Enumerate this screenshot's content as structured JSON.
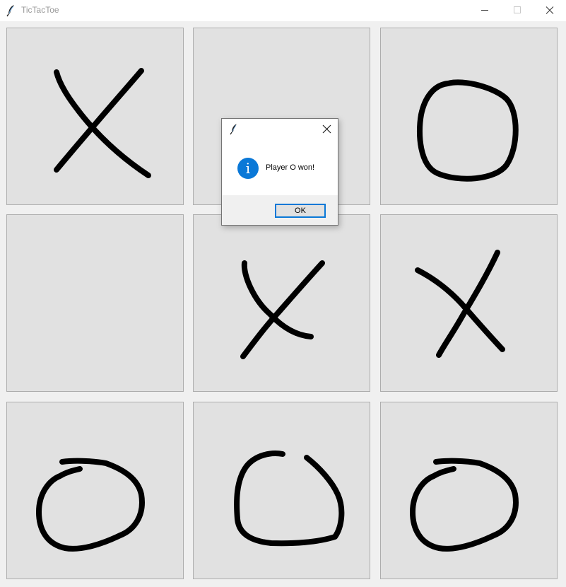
{
  "window": {
    "title": "TicTacToe",
    "icon": "feather-icon"
  },
  "board": {
    "cells": [
      {
        "row": 1,
        "col": 1,
        "mark": "X"
      },
      {
        "row": 1,
        "col": 2,
        "mark": ""
      },
      {
        "row": 1,
        "col": 3,
        "mark": "O"
      },
      {
        "row": 2,
        "col": 1,
        "mark": ""
      },
      {
        "row": 2,
        "col": 2,
        "mark": "X"
      },
      {
        "row": 2,
        "col": 3,
        "mark": "X"
      },
      {
        "row": 3,
        "col": 1,
        "mark": "O"
      },
      {
        "row": 3,
        "col": 2,
        "mark": "O"
      },
      {
        "row": 3,
        "col": 3,
        "mark": "O"
      }
    ]
  },
  "dialog": {
    "icon": "info-icon",
    "icon_glyph": "i",
    "message": "Player O won!",
    "ok_label": "OK"
  },
  "colors": {
    "cell_background": "#e1e1e1",
    "mark": "#000000",
    "accent": "#0a78d7"
  }
}
